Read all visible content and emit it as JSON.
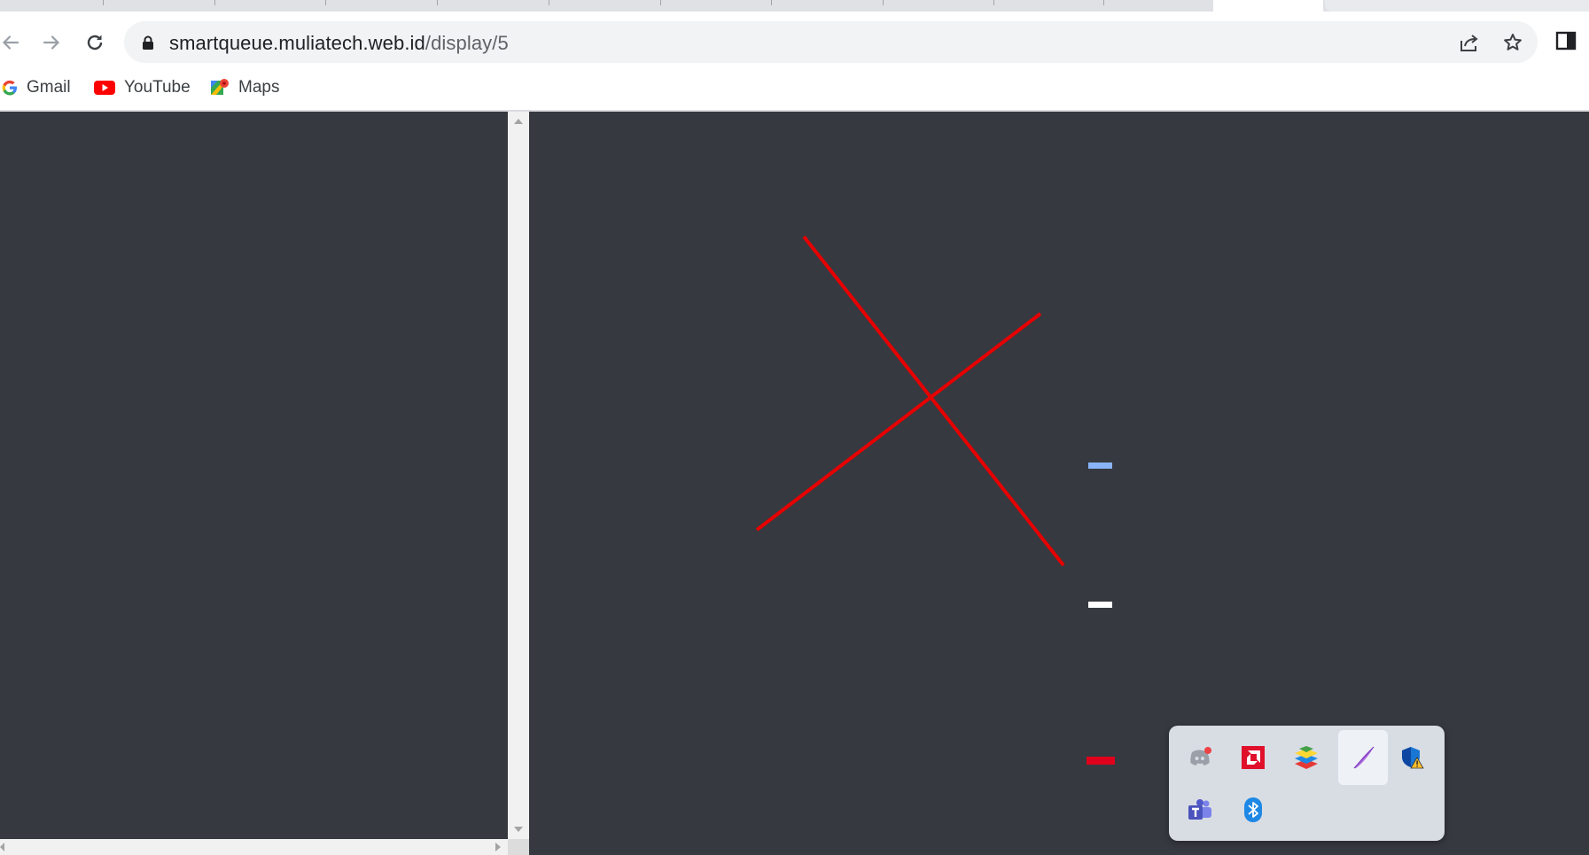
{
  "browser": {
    "url_host": "smartqueue.muliatech.web.id",
    "url_path": "/display/5"
  },
  "bookmarks": [
    {
      "label": "Gmail",
      "icon": "google-g-icon"
    },
    {
      "label": "YouTube",
      "icon": "youtube-icon"
    },
    {
      "label": "Maps",
      "icon": "maps-pin-icon"
    }
  ],
  "colors": {
    "content_bg": "#363940",
    "broken_mark": "#e60000",
    "dash_blue": "#8ab4f8",
    "dash_white": "#ffffff",
    "dash_red": "#e0001b"
  },
  "tray": {
    "icons": [
      "discord-icon",
      "amd-radeon-icon",
      "bluestacks-icon",
      "pen-feather-icon",
      "windows-security-warning-icon",
      "microsoft-teams-icon",
      "bluetooth-icon"
    ]
  }
}
